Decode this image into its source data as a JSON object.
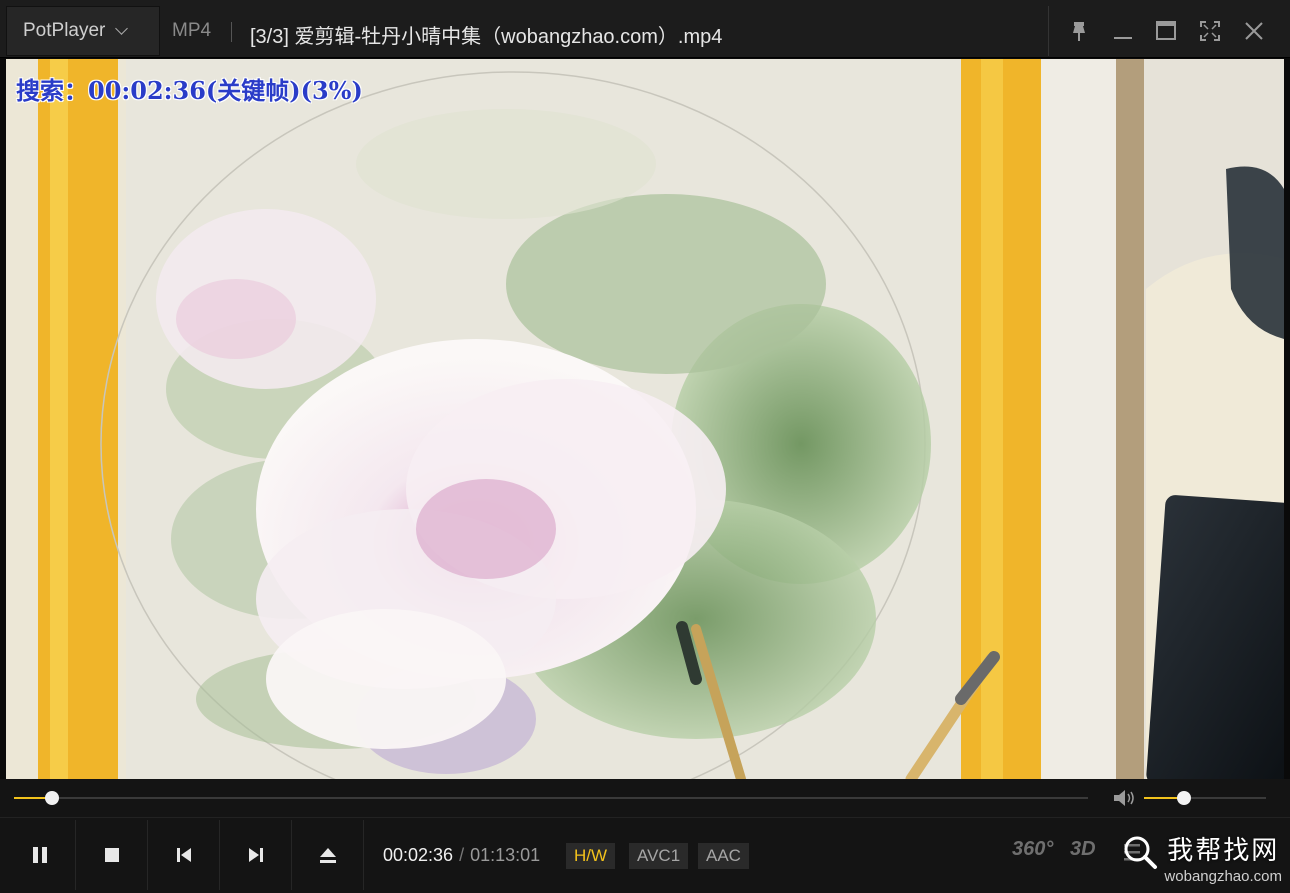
{
  "titlebar": {
    "app_name": "PotPlayer",
    "format": "MP4",
    "title": "[3/3] 爱剪辑-牡丹小晴中集（wobangzhao.com）.mp4",
    "buttons": [
      "pin-icon",
      "minimize-icon",
      "maximize-icon",
      "fullscreen-icon",
      "close-icon"
    ]
  },
  "osd": {
    "text": "搜索：00:02:36(关键帧)(3%)",
    "color": "#2a3cc8"
  },
  "playback": {
    "current_time": "00:02:36",
    "separator": "/",
    "duration": "01:13:01",
    "progress_fraction": 0.035,
    "volume_fraction": 0.33
  },
  "badges": {
    "hw": "H/W",
    "video_codec": "AVC1",
    "audio_codec": "AAC"
  },
  "right_buttons": {
    "vr": "360°",
    "three_d": "3D"
  },
  "watermark": {
    "cn": "我帮找网",
    "url": "wobangzhao.com"
  },
  "colors": {
    "accent": "#f2c21c",
    "bar_bg": "#141414",
    "title_bg": "#1c1c1c"
  }
}
